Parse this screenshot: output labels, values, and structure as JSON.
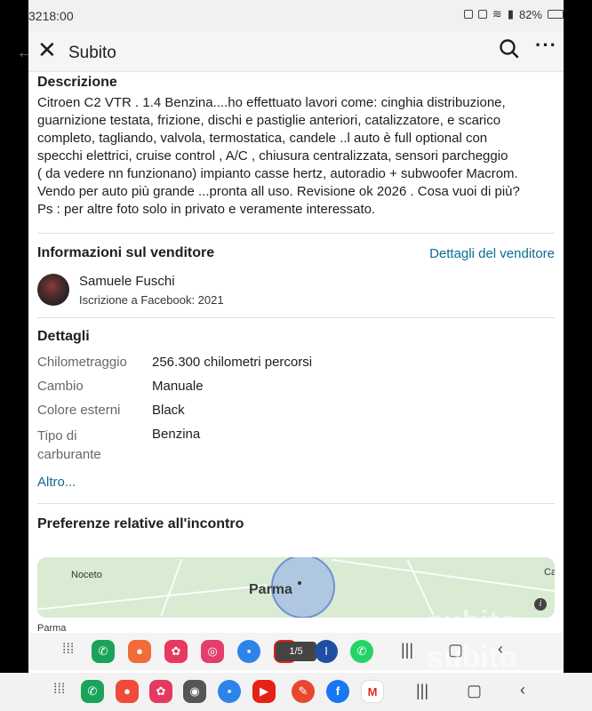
{
  "status": {
    "time": "3218:00",
    "battery": "82%"
  },
  "header": {
    "title": "Subito"
  },
  "description": {
    "title": "Descrizione",
    "text": "Citroen C2 VTR .  1.4 Benzina....ho effettuato lavori come: cinghia distribuzione,\nguarnizione testata, frizione, dischi e pastiglie anteriori, catalizzatore, e scarico\ncompleto,  tagliando, valvola, termostatica,  candele ..l auto è full optional con\nspecchi elettrici,  cruise control , A/C , chiusura centralizzata,  sensori parcheggio\n( da vedere nn funzionano) impianto casse hertz, autoradio + subwoofer Macrom.\nVendo per auto più grande ...pronta all uso. Revisione ok 2026 . Cosa vuoi di più?\nPs : per altre foto solo in privato e veramente interessato."
  },
  "seller": {
    "section_title": "Informazioni sul venditore",
    "link": "Dettagli del venditore",
    "name": "Samuele Fuschi",
    "joined": "Iscrizione a Facebook: 2021"
  },
  "details": {
    "title": "Dettagli",
    "rows": [
      {
        "label": "Chilometraggio",
        "value": "256.300 chilometri percorsi"
      },
      {
        "label": "Cambio",
        "value": "Manuale"
      },
      {
        "label": "Colore esterni",
        "value": "Black"
      },
      {
        "label": "Tipo di\ncarburante",
        "value": "Benzina"
      }
    ],
    "more": "Altro..."
  },
  "meeting": {
    "title": "Preferenze relative all'incontro",
    "map_city": "Parma",
    "map_town": "Noceto",
    "map_edge": "Cas",
    "footer_partial": "Parma"
  },
  "dock": {
    "media_badge": "1/5"
  },
  "watermark": {
    "text": "subito"
  },
  "colors": {
    "link": "#0a6c93",
    "label_gray": "#65676b"
  }
}
